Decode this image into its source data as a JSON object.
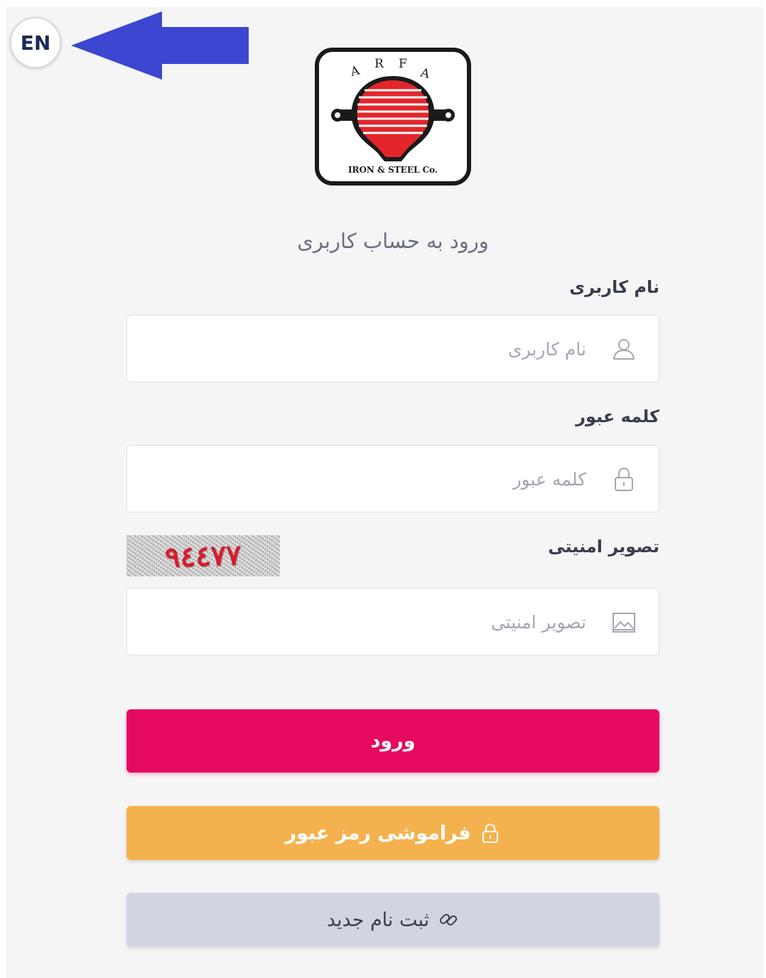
{
  "language_toggle": {
    "label": "EN"
  },
  "logo": {
    "top_text": "A R F A",
    "bottom_text": "IRON & STEEL Co."
  },
  "page_title": "ورود به حساب کاربری",
  "username": {
    "label": "نام کاربری",
    "placeholder": "نام کاربری",
    "value": "",
    "icon": "user-icon"
  },
  "password": {
    "label": "کلمه عبور",
    "placeholder": "کلمه عبور",
    "value": "",
    "icon": "lock-icon"
  },
  "captcha": {
    "label": "تصویر امنیتی",
    "placeholder": "تصویر امنیتی",
    "value": "",
    "image_text": "۹٤٤۷۷",
    "icon": "image-icon"
  },
  "buttons": {
    "login": "ورود",
    "forgot_password": "فراموشی رمز عبور",
    "register": "ثبت نام جدید"
  },
  "colors": {
    "login_button": "#e5095f",
    "forgot_button": "#f4b24f",
    "register_button": "#d2d4e1",
    "arrow": "#3c46d0",
    "logo_red": "#e2262b"
  }
}
